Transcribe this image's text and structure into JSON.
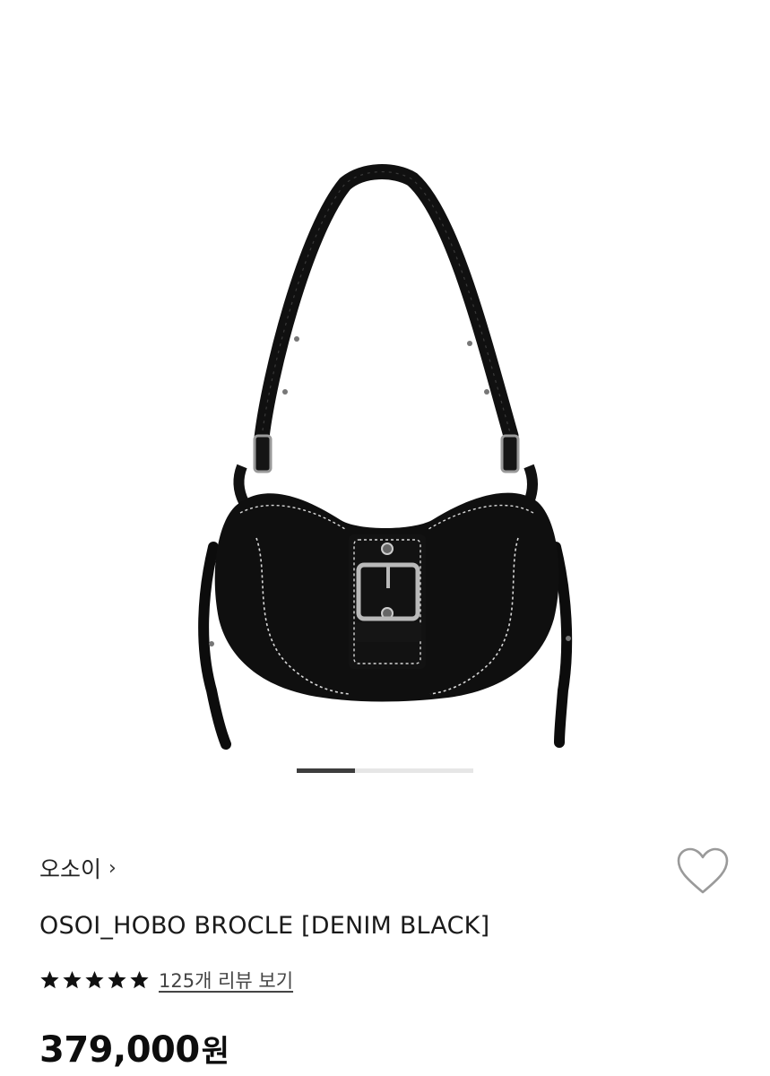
{
  "gallery": {
    "image": "black-hobo-shoulder-bag-with-buckle",
    "current_slide_fraction": 0.33
  },
  "brand": {
    "name": "오소이",
    "chevron_icon": "chevron-right-icon"
  },
  "wishlist": {
    "icon": "heart-outline-icon"
  },
  "product": {
    "title": "OSOI_HOBO BROCLE [DENIM BLACK]"
  },
  "rating": {
    "stars": 5,
    "star_icon": "star-icon",
    "review_link": "125개 리뷰 보기"
  },
  "price": {
    "value": "379,000",
    "unit": "원"
  },
  "colors": {
    "bag": "#0f0f0f",
    "stitch": "#d8d8d8",
    "metal": "#b9b9b9",
    "progress_track": "#e6e6e6",
    "progress_fill": "#3d3d3d"
  }
}
